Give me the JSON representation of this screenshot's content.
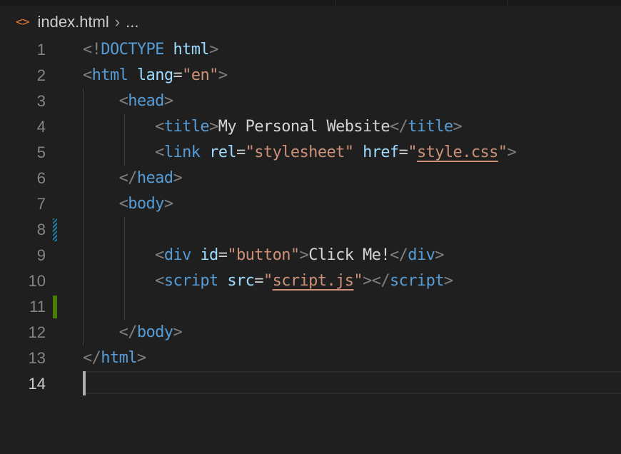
{
  "breadcrumb": {
    "icon": "html-file-icon",
    "icon_glyph": "<>",
    "file": "index.html",
    "separator": "›",
    "ellipsis": "..."
  },
  "editor": {
    "lines": [
      {
        "n": "1",
        "tokens": [
          [
            "p",
            "<!"
          ],
          [
            "tag",
            "DOCTYPE"
          ],
          [
            "p",
            " "
          ],
          [
            "attr",
            "html"
          ],
          [
            "p",
            ">"
          ]
        ]
      },
      {
        "n": "2",
        "tokens": [
          [
            "p",
            "<"
          ],
          [
            "tag",
            "html"
          ],
          [
            "p",
            " "
          ],
          [
            "attr",
            "lang"
          ],
          [
            "eq",
            "="
          ],
          [
            "str",
            "\"en\""
          ],
          [
            "p",
            ">"
          ]
        ]
      },
      {
        "n": "3",
        "tokens": [
          [
            "p",
            "    <"
          ],
          [
            "tag",
            "head"
          ],
          [
            "p",
            ">"
          ]
        ]
      },
      {
        "n": "4",
        "tokens": [
          [
            "p",
            "        <"
          ],
          [
            "tag",
            "title"
          ],
          [
            "p",
            ">"
          ],
          [
            "txt",
            "My Personal Website"
          ],
          [
            "p",
            "</"
          ],
          [
            "tag",
            "title"
          ],
          [
            "p",
            ">"
          ]
        ]
      },
      {
        "n": "5",
        "tokens": [
          [
            "p",
            "        <"
          ],
          [
            "tag",
            "link"
          ],
          [
            "p",
            " "
          ],
          [
            "attr",
            "rel"
          ],
          [
            "eq",
            "="
          ],
          [
            "str",
            "\"stylesheet\""
          ],
          [
            "p",
            " "
          ],
          [
            "attr",
            "href"
          ],
          [
            "eq",
            "="
          ],
          [
            "str",
            "\""
          ],
          [
            "strlink",
            "style.css"
          ],
          [
            "str",
            "\""
          ],
          [
            "p",
            ">"
          ]
        ]
      },
      {
        "n": "6",
        "tokens": [
          [
            "p",
            "    </"
          ],
          [
            "tag",
            "head"
          ],
          [
            "p",
            ">"
          ]
        ]
      },
      {
        "n": "7",
        "tokens": [
          [
            "p",
            "    <"
          ],
          [
            "tag",
            "body"
          ],
          [
            "p",
            ">"
          ]
        ]
      },
      {
        "n": "8",
        "tokens": []
      },
      {
        "n": "9",
        "tokens": [
          [
            "p",
            "        <"
          ],
          [
            "tag",
            "div"
          ],
          [
            "p",
            " "
          ],
          [
            "attr",
            "id"
          ],
          [
            "eq",
            "="
          ],
          [
            "str",
            "\"button\""
          ],
          [
            "p",
            ">"
          ],
          [
            "txt",
            "Click Me!"
          ],
          [
            "p",
            "</"
          ],
          [
            "tag",
            "div"
          ],
          [
            "p",
            ">"
          ]
        ]
      },
      {
        "n": "10",
        "tokens": [
          [
            "p",
            "        <"
          ],
          [
            "tag",
            "script"
          ],
          [
            "p",
            " "
          ],
          [
            "attr",
            "src"
          ],
          [
            "eq",
            "="
          ],
          [
            "str",
            "\""
          ],
          [
            "strlink",
            "script.js"
          ],
          [
            "str",
            "\""
          ],
          [
            "p",
            "></"
          ],
          [
            "tag",
            "script"
          ],
          [
            "p",
            ">"
          ]
        ]
      },
      {
        "n": "11",
        "tokens": []
      },
      {
        "n": "12",
        "tokens": [
          [
            "p",
            "    </"
          ],
          [
            "tag",
            "body"
          ],
          [
            "p",
            ">"
          ]
        ]
      },
      {
        "n": "13",
        "tokens": [
          [
            "p",
            "</"
          ],
          [
            "tag",
            "html"
          ],
          [
            "p",
            ">"
          ]
        ]
      },
      {
        "n": "14",
        "tokens": []
      }
    ],
    "active_line": "14",
    "git_modified_lines": [
      "8"
    ],
    "git_added_lines": [
      "11"
    ]
  },
  "colors": {
    "tag": "#569cd6",
    "attr": "#9cdcfe",
    "string": "#ce9178",
    "punct": "#808080",
    "text": "#d4d4d4",
    "git_added": "#487e02",
    "git_modified": "#1b81a8",
    "icon_html": "#e37933"
  }
}
